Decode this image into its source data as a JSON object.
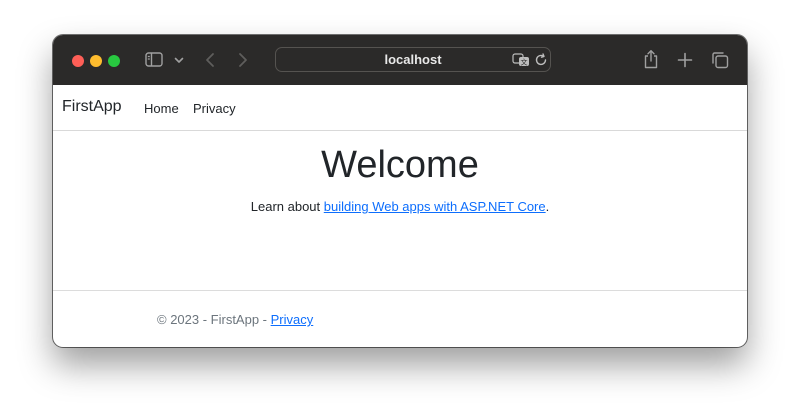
{
  "browser": {
    "url": "localhost",
    "traffic_lights": [
      "close",
      "minimize",
      "zoom"
    ],
    "colors": {
      "toolbar_bg": "#2b2a29",
      "close": "#fe5f57",
      "minimize": "#febc2e",
      "zoom": "#28c840"
    }
  },
  "navbar": {
    "brand": "FirstApp",
    "links": [
      {
        "label": "Home"
      },
      {
        "label": "Privacy"
      }
    ]
  },
  "main": {
    "heading": "Welcome",
    "lead_prefix": "Learn about ",
    "lead_link": "building Web apps with ASP.NET Core",
    "lead_suffix": "."
  },
  "footer": {
    "text": "© 2023 - FirstApp - ",
    "link": "Privacy"
  },
  "colors": {
    "link": "#0d6efd",
    "text": "#212529",
    "muted": "#6c757d"
  }
}
